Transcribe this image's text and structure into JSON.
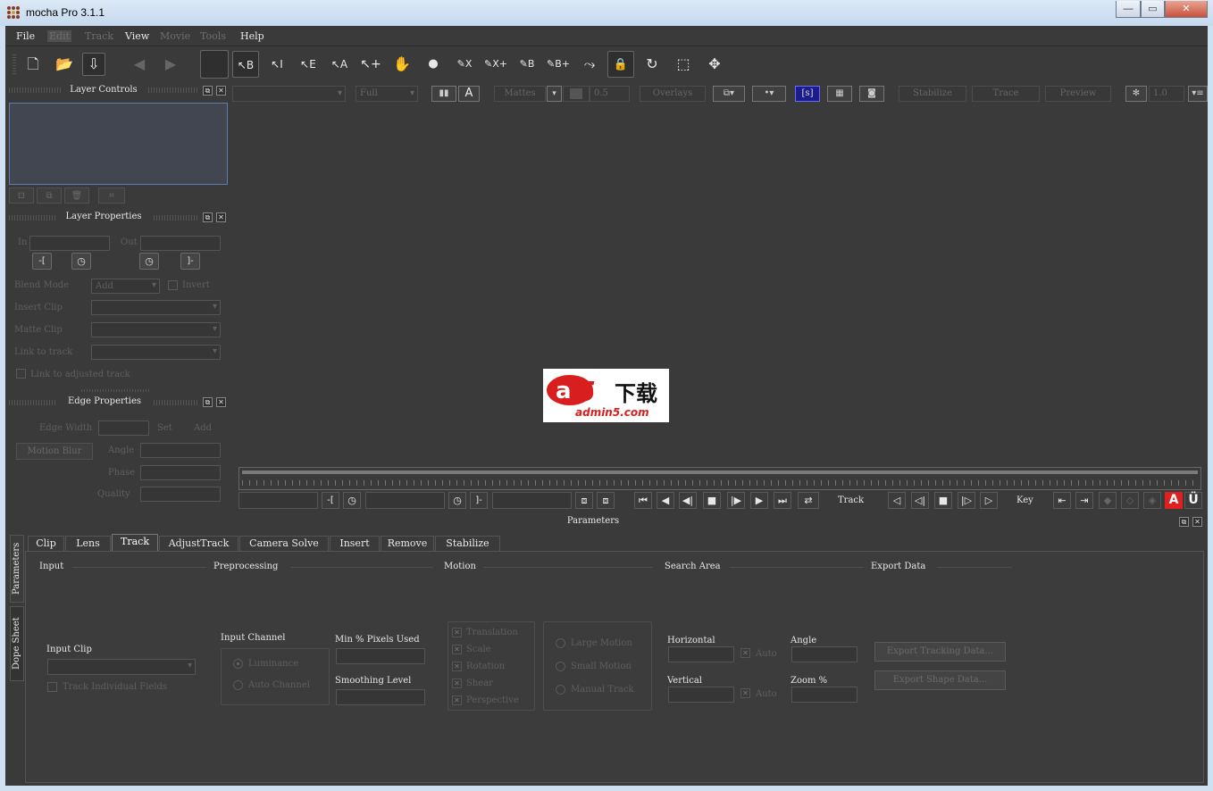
{
  "window": {
    "title": "mocha Pro 3.1.1",
    "minimize": "▭",
    "maximize": "◻",
    "close": "✕"
  },
  "menu": [
    {
      "label": "File",
      "enabled": true
    },
    {
      "label": "Edit",
      "enabled": false
    },
    {
      "label": "Track",
      "enabled": false
    },
    {
      "label": "View",
      "enabled": true
    },
    {
      "label": "Movie",
      "enabled": false
    },
    {
      "label": "Tools",
      "enabled": false
    },
    {
      "label": "Help",
      "enabled": true
    }
  ],
  "toolbar": {
    "new": "🗋",
    "open": "📂",
    "save": "⇩",
    "back": "◀",
    "forward": "▶",
    "tools": [
      {
        "name": "select-b",
        "label": "↖B"
      },
      {
        "name": "select-i",
        "label": "↖I"
      },
      {
        "name": "select-e",
        "label": "↖E"
      },
      {
        "name": "select-a",
        "label": "↖A"
      },
      {
        "name": "add-point",
        "label": "↖+"
      },
      {
        "name": "hand",
        "label": "✋"
      },
      {
        "name": "point",
        "label": "●"
      },
      {
        "name": "pen-x",
        "label": "✎X"
      },
      {
        "name": "pen-xplus",
        "label": "✎X+"
      },
      {
        "name": "pen-b",
        "label": "✎B"
      },
      {
        "name": "pen-bplus",
        "label": "✎B+"
      },
      {
        "name": "spline",
        "label": "⤳"
      },
      {
        "name": "lock",
        "label": "🔒"
      },
      {
        "name": "rotate",
        "label": "↻"
      },
      {
        "name": "scale",
        "label": "⬚"
      },
      {
        "name": "move",
        "label": "✥"
      }
    ]
  },
  "layer_controls": {
    "title": "Layer Controls"
  },
  "layer_properties": {
    "title": "Layer Properties",
    "in_label": "In",
    "out_label": "Out",
    "blend_mode_label": "Blend Mode",
    "blend_mode_value": "Add",
    "invert_label": "Invert",
    "insert_clip_label": "Insert Clip",
    "matte_clip_label": "Matte Clip",
    "link_to_track_label": "Link to track",
    "link_adjusted_label": "Link to adjusted track"
  },
  "edge_properties": {
    "title": "Edge Properties",
    "edge_width_label": "Edge Width",
    "set_label": "Set",
    "add_label": "Add",
    "motion_blur_label": "Motion Blur",
    "angle_label": "Angle",
    "phase_label": "Phase",
    "quality_label": "Quality"
  },
  "view_toolbar": {
    "resolution": "Full",
    "alpha_label": "A",
    "mattes_label": "Mattes",
    "opacity": "0.5",
    "overlays_label": "Overlays",
    "stabilize_label": "Stabilize",
    "trace_label": "Trace",
    "preview_label": "Preview",
    "zoom": "1.0"
  },
  "watermark": {
    "brand": "a5下载",
    "domain": "admin5.com"
  },
  "transport": {
    "track_label": "Track",
    "key_label": "Key"
  },
  "parameters": {
    "title": "Parameters",
    "side_tabs": [
      "Parameters",
      "Dope Sheet"
    ],
    "tabs": [
      "Clip",
      "Lens",
      "Track",
      "AdjustTrack",
      "Camera Solve",
      "Insert",
      "Remove",
      "Stabilize"
    ],
    "active_tab": "Track",
    "sections": {
      "input": "Input",
      "preprocessing": "Preprocessing",
      "motion": "Motion",
      "search_area": "Search Area",
      "export_data": "Export Data"
    },
    "input_clip_label": "Input Clip",
    "track_individual_label": "Track Individual Fields",
    "input_channel_label": "Input Channel",
    "luminance_label": "Luminance",
    "auto_channel_label": "Auto Channel",
    "min_pixels_label": "Min % Pixels Used",
    "smoothing_label": "Smoothing Level",
    "motion_options": [
      "Translation",
      "Scale",
      "Rotation",
      "Shear",
      "Perspective"
    ],
    "motion_modes": [
      "Large Motion",
      "Small Motion",
      "Manual Track"
    ],
    "horizontal_label": "Horizontal",
    "vertical_label": "Vertical",
    "auto_label": "Auto",
    "angle_label": "Angle",
    "zoom_label": "Zoom %",
    "export_tracking_label": "Export Tracking Data...",
    "export_shape_label": "Export Shape Data..."
  }
}
